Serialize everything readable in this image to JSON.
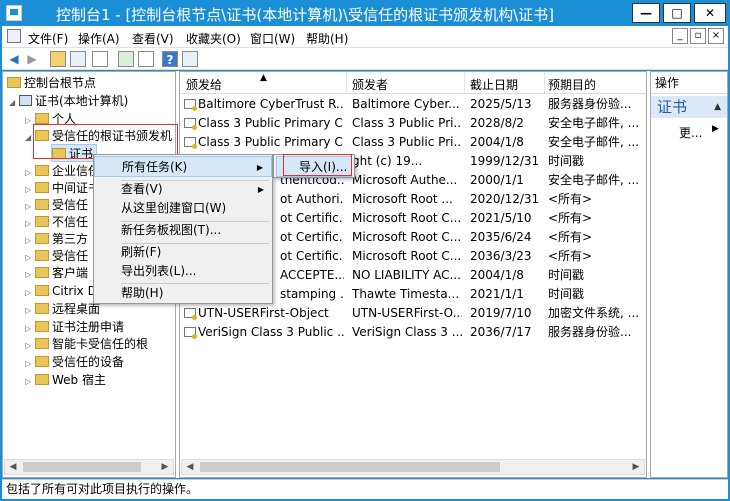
{
  "window": {
    "title": "控制台1 - [控制台根节点\\证书(本地计算机)\\受信任的根证书颁发机构\\证书]",
    "buttons": {
      "minimize": "—",
      "maximize": "□",
      "close": "✕"
    }
  },
  "menu": {
    "items": [
      "文件(F)",
      "操作(A)",
      "查看(V)",
      "收藏夹(O)",
      "窗口(W)",
      "帮助(H)"
    ],
    "mdi_buttons": [
      "_",
      "▫",
      "×"
    ]
  },
  "tree": {
    "root": "控制台根节点",
    "computer": "证书(本地计算机)",
    "items": [
      "个人",
      "受信任的根证书颁发机",
      "证书",
      "企业信任",
      "中间证书",
      "受信任",
      "不信任",
      "第三方",
      "受信任",
      "客户端",
      "Citrix D",
      "远程桌面",
      "证书注册申请",
      "智能卡受信任的根",
      "受信任的设备",
      "Web 宿主"
    ]
  },
  "list": {
    "columns": [
      "颁发给",
      "颁发者",
      "截止日期",
      "预期目的"
    ],
    "rows": [
      [
        "Baltimore CyberTrust R...",
        "Baltimore Cyber...",
        "2025/5/13",
        "服务器身份验..."
      ],
      [
        "Class 3 Public Primary C...",
        "Class 3 Public Pri...",
        "2028/8/2",
        "安全电子邮件, ..."
      ],
      [
        "Class 3 Public Primary C...",
        "Class 3 Public Pri...",
        "2004/1/8",
        "安全电子邮件, ..."
      ],
      [
        "",
        "ght (c) 19...",
        "1999/12/31",
        "时间戳"
      ],
      [
        "thenticod...",
        "Microsoft Authe...",
        "2000/1/1",
        "安全电子邮件, ..."
      ],
      [
        "ot Authori...",
        "Microsoft Root ...",
        "2020/12/31",
        "<所有>"
      ],
      [
        "ot Certific...",
        "Microsoft Root C...",
        "2021/5/10",
        "<所有>"
      ],
      [
        "ot Certific...",
        "Microsoft Root C...",
        "2035/6/24",
        "<所有>"
      ],
      [
        "ot Certific...",
        "Microsoft Root C...",
        "2036/3/23",
        "<所有>"
      ],
      [
        "ACCEPTE...",
        "NO LIABILITY AC...",
        "2004/1/8",
        "时间戳"
      ],
      [
        "stamping ...",
        "Thawte Timesta...",
        "2021/1/1",
        "时间戳"
      ],
      [
        "UTN-USERFirst-Object",
        "UTN-USERFirst-O...",
        "2019/7/10",
        "加密文件系统, ..."
      ],
      [
        "VeriSign Class 3 Public ...",
        "VeriSign Class 3 ...",
        "2036/7/17",
        "服务器身份验..."
      ]
    ]
  },
  "actions": {
    "header": "操作",
    "section": "证书",
    "more": "更..."
  },
  "context_menu": {
    "all_tasks": "所有任务(K)",
    "view": "查看(V)",
    "new_window": "从这里创建窗口(W)",
    "new_taskpad": "新任务板视图(T)...",
    "refresh": "刷新(F)",
    "export": "导出列表(L)...",
    "help": "帮助(H)"
  },
  "submenu": {
    "import": "导入(I)..."
  },
  "statusbar": {
    "text": "包括了所有可对此项目执行的操作。"
  },
  "colors": {
    "titlebar": "#1a8fd6",
    "highlight": "#d6e8f8",
    "annotation": "#e03030"
  }
}
